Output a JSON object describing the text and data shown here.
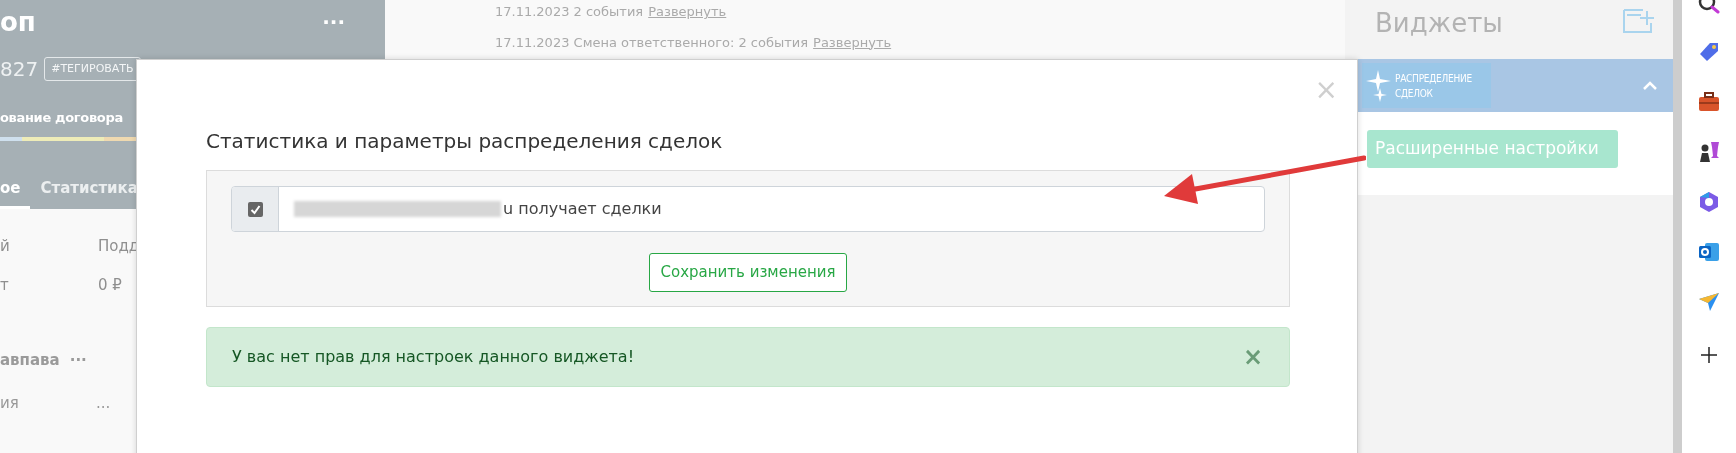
{
  "left_panel": {
    "title": "оп",
    "menu": "···",
    "number": "827",
    "tag_button": "#ТЕГИРОВАТЬ",
    "stage": "ование договора",
    "stage_bar": [
      {
        "color": "#cfe0ee"
      },
      {
        "color": "#eeecb8"
      },
      {
        "color": "#efd9b0"
      }
    ],
    "tabs": [
      {
        "label": "ое",
        "selected": true
      },
      {
        "label": "Статистика",
        "selected": false
      }
    ],
    "rows": [
      {
        "column_1": "й",
        "column_2": "Подд"
      },
      {
        "column_1": "т",
        "column_2": "0 ₽"
      }
    ],
    "contact": {
      "name": "авпава",
      "menu": "···"
    },
    "last_row": {
      "column_1": "ия",
      "column_2": "..."
    }
  },
  "feed": [
    {
      "text": "17.11.2023 2 события",
      "link": "Развернуть"
    },
    {
      "text": "17.11.2023 Смена ответственного: 2 события",
      "link": "Развернуть"
    }
  ],
  "widgets_panel": {
    "title": "Виджеты",
    "widget": {
      "name_lines": [
        "РАСПРЕДЕЛЕНИЕ",
        "СДЕЛОК"
      ],
      "expanded": true,
      "button": "Расширенные настройки"
    }
  },
  "modal": {
    "close": "×",
    "title": "Статистика и параметры распределения сделок",
    "users": [
      {
        "checked": true,
        "redacted": true,
        "text": "u получает сделки"
      }
    ],
    "save_button": "Сохранить изменения",
    "alert": {
      "text": "У вас нет прав для настроек данного виджета!",
      "close": "×"
    }
  }
}
